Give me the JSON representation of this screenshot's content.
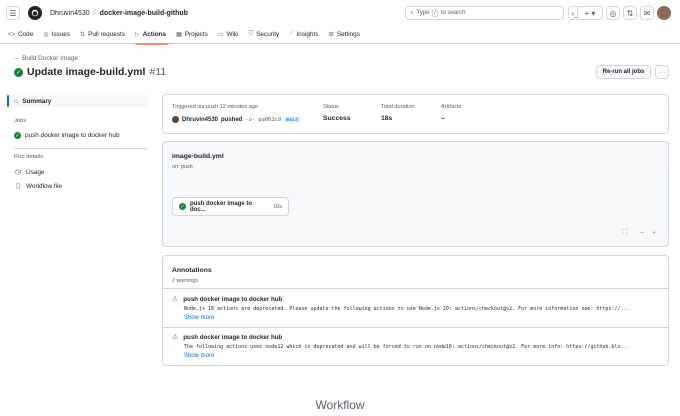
{
  "header": {
    "owner": "Dhruvin4530",
    "separator": "/",
    "repo": "docker-image-build-github",
    "search_prefix": "Type",
    "search_key": "/",
    "search_suffix": "to search"
  },
  "tabs": [
    {
      "label": "Code",
      "icon": "<>"
    },
    {
      "label": "Issues",
      "icon": "◎"
    },
    {
      "label": "Pull requests",
      "icon": "⇅"
    },
    {
      "label": "Actions",
      "icon": "▷"
    },
    {
      "label": "Projects",
      "icon": "▦"
    },
    {
      "label": "Wiki",
      "icon": "▭"
    },
    {
      "label": "Security",
      "icon": "⛉"
    },
    {
      "label": "Insights",
      "icon": "⟋"
    },
    {
      "label": "Settings",
      "icon": "⚙"
    }
  ],
  "page": {
    "back_label": "← Build Docker Image",
    "title": "Update image-build.yml",
    "run_number": "#11",
    "rerun_label": "Re-run all jobs",
    "more_label": "···"
  },
  "sidebar": {
    "summary": "Summary",
    "jobs_heading": "Jobs",
    "job": "push docker image to docker hub",
    "run_details_heading": "Run details",
    "usage": "Usage",
    "workflow_file": "Workflow file"
  },
  "run_info": {
    "trigger_label": "Triggered via push 12 minutes ago",
    "actor": "Dhruvin4530",
    "action": "pushed",
    "sha": "-o- pa061c9",
    "branch": "main",
    "status_label": "Status",
    "status_value": "Success",
    "duration_label": "Total duration",
    "duration_value": "18s",
    "artifacts_label": "Artifacts",
    "artifacts_value": "–"
  },
  "workflow": {
    "file": "image-build.yml",
    "on": "on: push",
    "job_name": "push docker image to doc...",
    "job_duration": "10s"
  },
  "annotations": {
    "title": "Annotations",
    "count": "2 warnings",
    "items": [
      {
        "title": "push docker image to docker hub",
        "message": "Node.js 16 actions are deprecated. Please update the following actions to use Node.js 20: actions/checkout@v2. For more information see: https://...",
        "show_more": "Show more"
      },
      {
        "title": "push docker image to docker hub",
        "message": "The following actions uses node12 which is deprecated and will be forced to run on node16: actions/checkout@v2. For more info: https://github.blo...",
        "show_more": "Show more"
      }
    ]
  },
  "caption": "Workflow",
  "colors": {
    "success": "#1a7f37",
    "warning": "#9a6700",
    "link": "#0969da",
    "active_tab": "#fd8c73"
  }
}
